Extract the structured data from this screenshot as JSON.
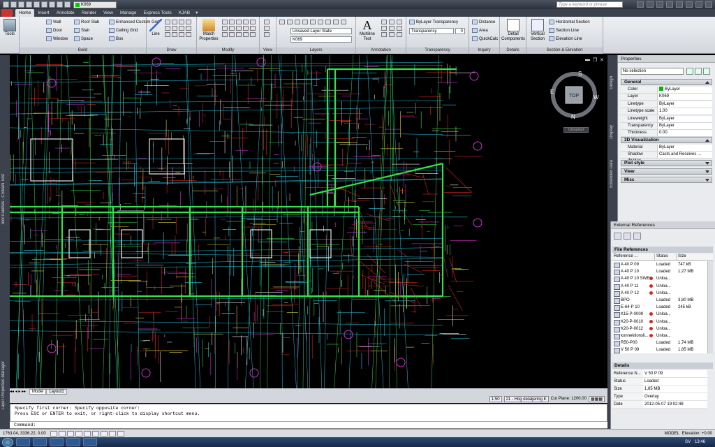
{
  "titlebar": {
    "layer_name": "K069",
    "search_placeholder": "Type a keyword or phrase"
  },
  "ribbon_tabs": [
    "Home",
    "Insert",
    "Annotate",
    "Render",
    "View",
    "Manage",
    "Express Tools",
    "KJAB"
  ],
  "ribbon": {
    "tools_label": "Tools",
    "build": {
      "title": "Build",
      "wall": "Wall",
      "door": "Door",
      "window": "Window",
      "roof_slab": "Roof Slab",
      "stair": "Stair",
      "space": "Space",
      "custom_grid": "Enhanced Custom Grid",
      "ceiling_grid": "Ceiling Grid",
      "box": "Box"
    },
    "draw": {
      "title": "Draw",
      "line": "Line"
    },
    "modify": {
      "title": "Modify",
      "match": "Match\nProperties"
    },
    "view": {
      "title": "View"
    },
    "layers": {
      "title": "Layers",
      "layer_state": "Unsaved Layer State",
      "layer": "K069"
    },
    "annotation": {
      "title": "Annotation",
      "multiline": "Multiline\nText"
    },
    "transparency": {
      "title": "Transparency",
      "bylayer": "ByLayer Transparency",
      "label": "Transparency",
      "value": "0"
    },
    "inquiry": {
      "title": "Inquiry",
      "distance": "Distance",
      "area": "Area",
      "quickcalc": "QuickCalc"
    },
    "details": {
      "title": "Details",
      "detail_components": "Detail\nComponents"
    },
    "section": {
      "title": "Section & Elevation",
      "vertical": "Vertical\nSection",
      "horizontal": "Horizontal Section",
      "section_line": "Section Line",
      "elevation_line": "Elevation Line"
    }
  },
  "left_palettes": {
    "tool_palettes": "Tool Palettes - CSMaN Test",
    "layer_manager": "Layer Properties Manager"
  },
  "viewcube": {
    "top": "TOP",
    "n": "N",
    "s": "S",
    "e": "E",
    "w": "W",
    "unnamed": "Unnamed"
  },
  "layout_tabs": [
    "Model",
    "Layout1"
  ],
  "viewport_status": {
    "scale": "1:50",
    "detail": "21 - Hög detaljering K",
    "cut_plane": "Cut Plane: 1200.00"
  },
  "command_line": {
    "line1": "Specify first corner: Specify opposite corner:",
    "line2": "Press ESC or ENTER to exit, or right-click to display shortcut menu.",
    "prompt": "Command:"
  },
  "statusbar": {
    "coords": "1763.04, 3336.22, 0.00",
    "model": "MODEL",
    "elevation": "Elevation: +0.00"
  },
  "taskbar": {
    "lang": "SV",
    "clock": "13:46"
  },
  "properties": {
    "header": "Properties",
    "selection": "No selection",
    "side_tabs": [
      "Design",
      "Display",
      "Extended Data"
    ],
    "sections": {
      "general": "General",
      "visualization": "3D Visualization",
      "plot_style": "Plot style",
      "view": "View",
      "misc": "Misc"
    },
    "general_rows": [
      {
        "k": "Color",
        "v": "ByLayer"
      },
      {
        "k": "Layer",
        "v": "K069"
      },
      {
        "k": "Linetype",
        "v": "ByLayer"
      },
      {
        "k": "Linetype scale",
        "v": "1.00"
      },
      {
        "k": "Lineweight",
        "v": "ByLayer"
      },
      {
        "k": "Transparency",
        "v": "ByLayer"
      },
      {
        "k": "Thickness",
        "v": "0.00"
      }
    ],
    "viz_rows": [
      {
        "k": "Material",
        "v": "ByLayer"
      },
      {
        "k": "Shadow display",
        "v": "Casts and Receives ..."
      }
    ]
  },
  "xref": {
    "header": "External References",
    "file_refs": "File References",
    "columns": [
      "Reference ...",
      "Status",
      "Size"
    ],
    "rows": [
      {
        "name": "A 40 P 09",
        "status": "Loaded",
        "size": "747 kB",
        "warn": false
      },
      {
        "name": "A 40 P 10",
        "status": "Loaded",
        "size": "1,27 MB",
        "warn": false
      },
      {
        "name": "A 40 P 10 SWE...",
        "status": "Unloa...",
        "size": "",
        "warn": true
      },
      {
        "name": "A 40 P 11",
        "status": "Unloa...",
        "size": "",
        "warn": true
      },
      {
        "name": "A 40 P 12",
        "status": "Unloa...",
        "size": "",
        "warn": true
      },
      {
        "name": "BPO",
        "status": "Loaded",
        "size": "3,80 MB",
        "warn": false
      },
      {
        "name": "E-64-P 10",
        "status": "Loaded",
        "size": "245 kB",
        "warn": false
      },
      {
        "name": "K15-P-0009",
        "status": "Unloa...",
        "size": "",
        "warn": true
      },
      {
        "name": "K20-P-0010",
        "status": "Unloa...",
        "size": "",
        "warn": true
      },
      {
        "name": "K20-P-0012",
        "status": "Unloa...",
        "size": "",
        "warn": true
      },
      {
        "name": "konnektionsli...",
        "status": "Unloa...",
        "size": "",
        "warn": true
      },
      {
        "name": "R50-P00",
        "status": "Loaded",
        "size": "1,74 MB",
        "warn": false
      },
      {
        "name": "V 50 P 09",
        "status": "Loaded",
        "size": "1,85 MB",
        "warn": false
      }
    ],
    "details_title": "Details",
    "details": [
      {
        "k": "Reference N...",
        "v": "V 50 P 09"
      },
      {
        "k": "Status",
        "v": "Loaded"
      },
      {
        "k": "Size",
        "v": "1,85 MB"
      },
      {
        "k": "Type",
        "v": "Overlay"
      },
      {
        "k": "Date",
        "v": "2012-05-07 19:02:48"
      }
    ]
  },
  "colors": {
    "canvas": "#000000",
    "ribbon_dark": "#3b424d",
    "cad_green": "#33e04a",
    "cad_red": "#e02020",
    "cad_cyan": "#25c8e0",
    "cad_white": "#e8e8e8",
    "cad_magenta": "#d030d0",
    "cad_yellow": "#e0d040"
  }
}
